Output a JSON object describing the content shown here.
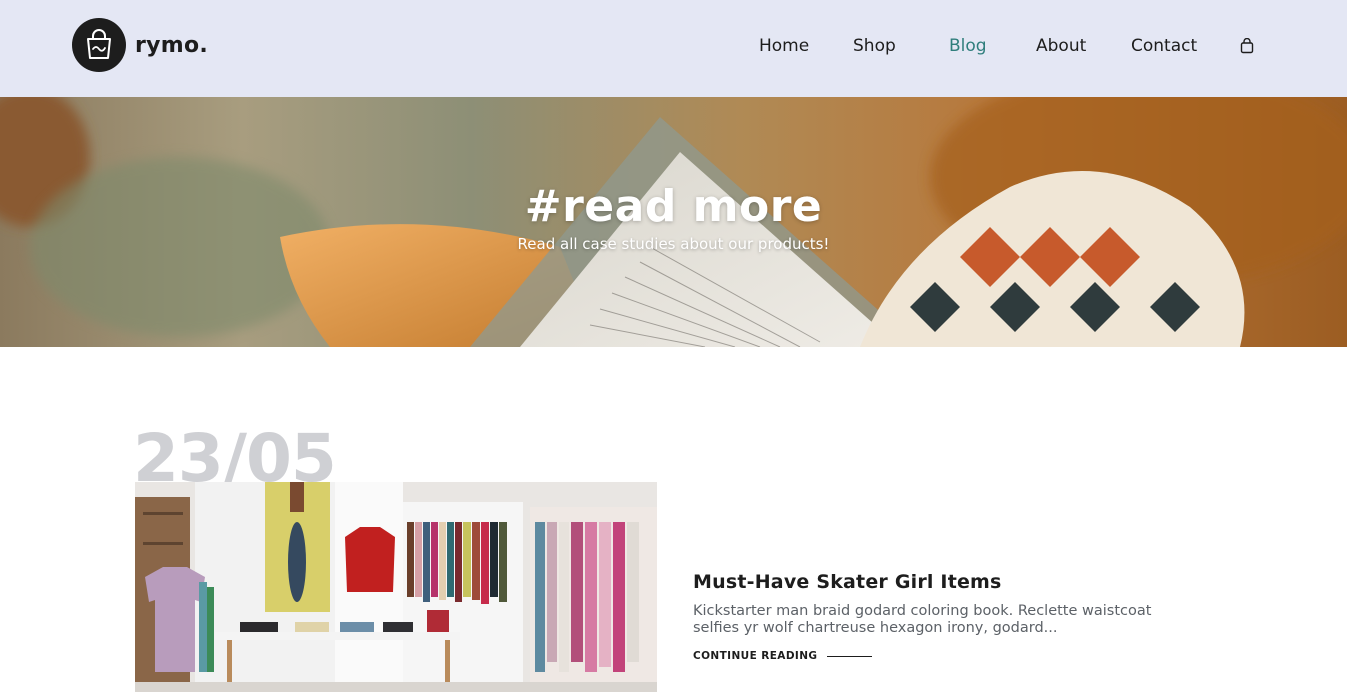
{
  "brand": {
    "name": "rymo.",
    "logo_icon": "shopping-bag-icon"
  },
  "nav": {
    "items": [
      {
        "label": "Home",
        "active": false
      },
      {
        "label": "Shop",
        "active": false
      },
      {
        "label": "Blog",
        "active": true
      },
      {
        "label": "About",
        "active": false
      },
      {
        "label": "Contact",
        "active": false
      }
    ],
    "cart_icon": "shopping-bag-icon"
  },
  "hero": {
    "title": "#read more",
    "subtitle": "Read all case studies about our products!"
  },
  "post": {
    "date": "23/05",
    "title": "Must-Have Skater Girl Items",
    "excerpt": "Kickstarter man braid godard coloring book. Reclette waistcoat selfies yr wolf chartreuse hexagon irony, godard...",
    "read_more": "CONTINUE READING"
  },
  "colors": {
    "header_bg": "#e4e7f4",
    "accent": "#2f7e7c",
    "text": "#1d1d1d",
    "muted_text": "#5c6167",
    "date_watermark": "#cfd0d4"
  }
}
